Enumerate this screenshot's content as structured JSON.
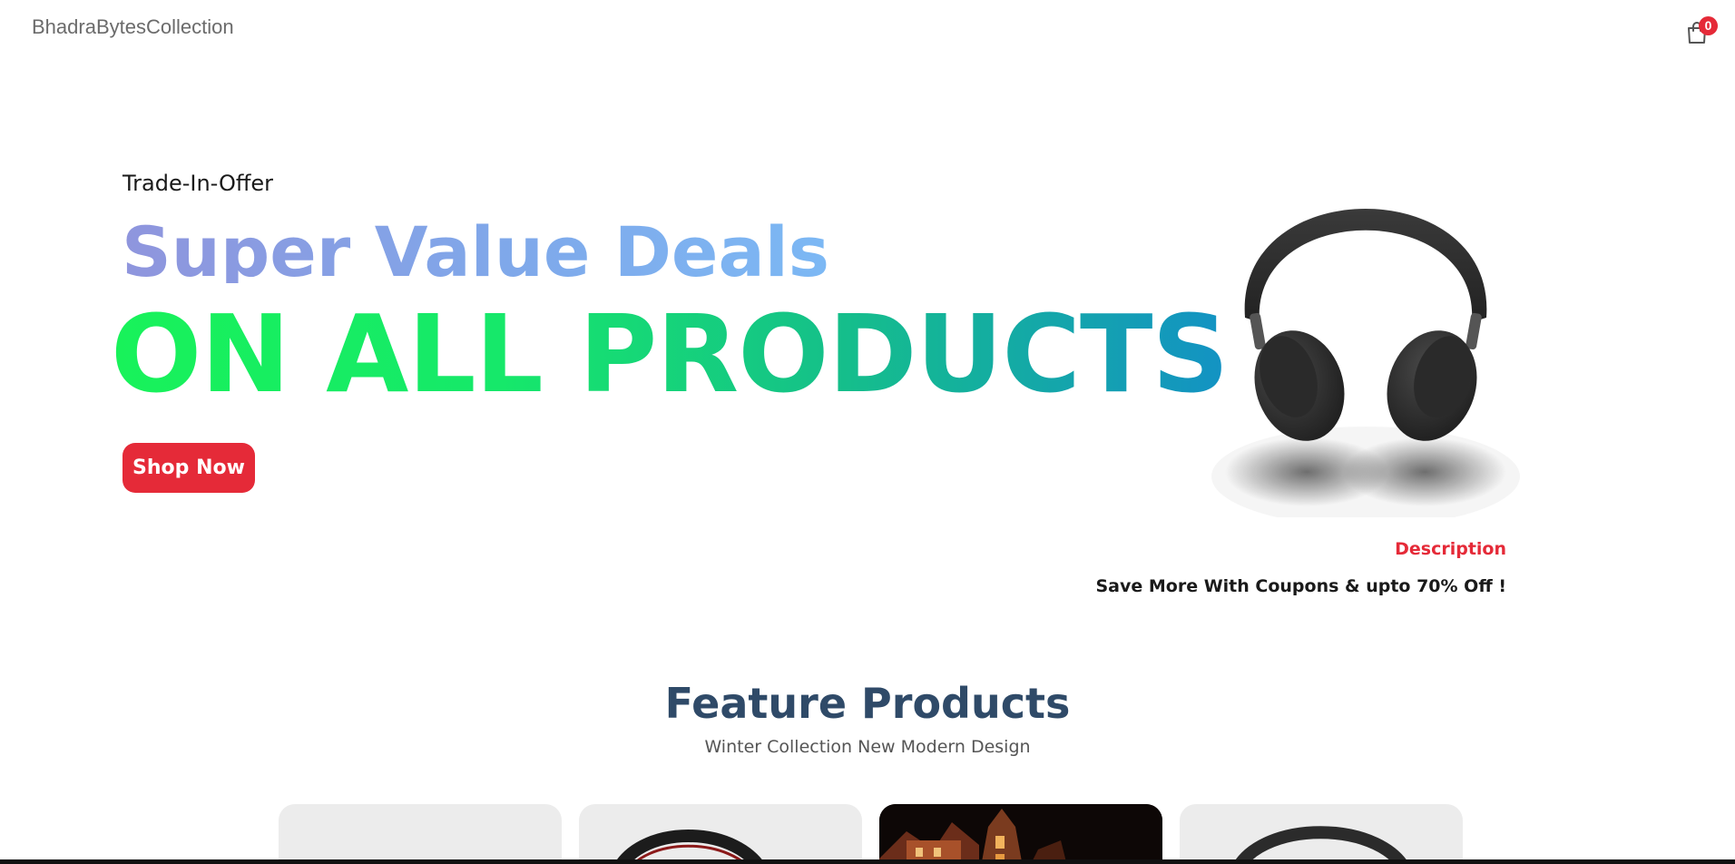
{
  "navbar": {
    "brand": "BhadraBytesCollection",
    "cart_count": "0"
  },
  "hero": {
    "eyebrow": "Trade-In-Offer",
    "title": "Super Value Deals",
    "subtitle": "ON ALL PRODUCTS",
    "cta_label": "Shop Now",
    "image_alt": "Headphones product image",
    "description_label": "Description",
    "description_text": "Save More With Coupons & upto 70% Off !"
  },
  "featured": {
    "title": "Feature Products",
    "subtitle": "Winter Collection New Modern Design",
    "products": [
      {
        "kind": "light"
      },
      {
        "kind": "headphones"
      },
      {
        "kind": "photo"
      },
      {
        "kind": "headphones"
      }
    ]
  },
  "colors": {
    "accent": "#e52a38",
    "heading": "#2f4a68",
    "title_gradient": [
      "#8f95dd",
      "#7cb8f4"
    ],
    "subtitle_gradient": [
      "#18f25a",
      "#1392c4"
    ]
  }
}
